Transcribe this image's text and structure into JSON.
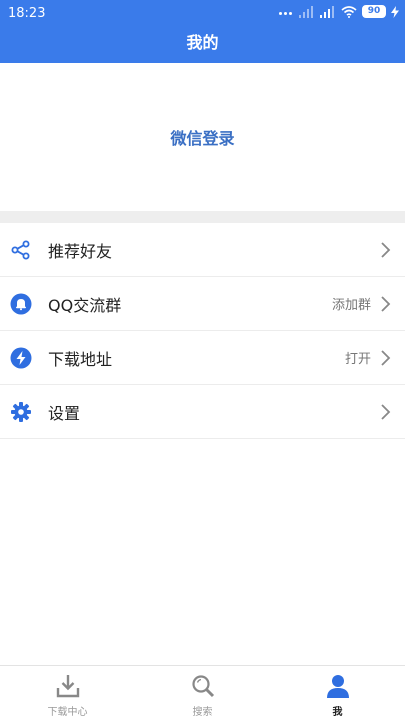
{
  "status_bar": {
    "time": "18:23",
    "battery": "90"
  },
  "header": {
    "title": "我的"
  },
  "login": {
    "label": "微信登录"
  },
  "menu": {
    "items": [
      {
        "label": "推荐好友",
        "value": "",
        "icon": "share-icon"
      },
      {
        "label": "QQ交流群",
        "value": "添加群",
        "icon": "bell-icon"
      },
      {
        "label": "下载地址",
        "value": "打开",
        "icon": "lightning-icon"
      },
      {
        "label": "设置",
        "value": "",
        "icon": "gear-icon"
      }
    ]
  },
  "bottom_nav": {
    "tabs": [
      {
        "label": "下载中心",
        "icon": "download-icon"
      },
      {
        "label": "搜索",
        "icon": "search-icon"
      },
      {
        "label": "我",
        "icon": "user-icon"
      }
    ]
  },
  "colors": {
    "primary": "#3a7bea",
    "icon_blue": "#2f6ee0",
    "divider": "#eeeeee"
  }
}
